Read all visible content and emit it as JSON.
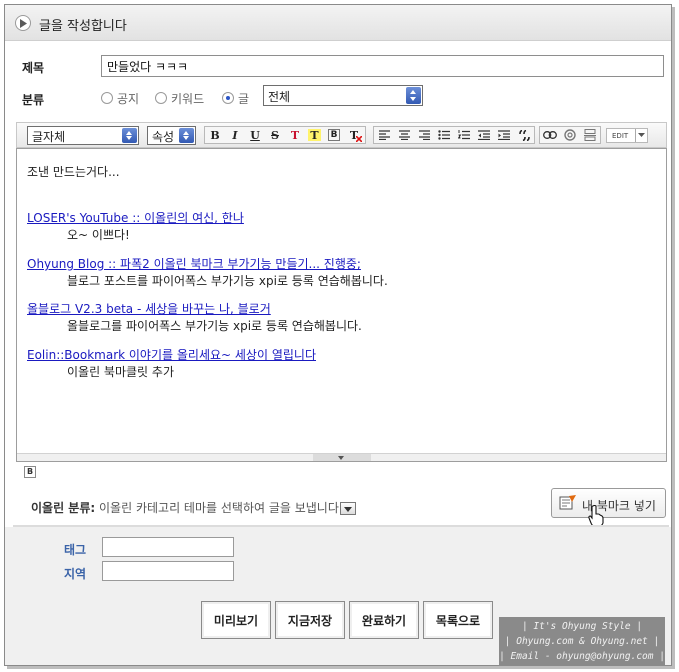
{
  "header": {
    "title": "글을 작성합니다"
  },
  "form": {
    "subject_label": "제목",
    "subject_value": "만들었다 ㅋㅋㅋ",
    "category_label": "분류",
    "radios": [
      {
        "label": "공지",
        "checked": false
      },
      {
        "label": "키워드",
        "checked": false
      },
      {
        "label": "글",
        "checked": true
      }
    ],
    "category_select": "전체"
  },
  "toolbar": {
    "font_select": "글자체",
    "attr_select": "속성",
    "bold": "B",
    "italic": "I",
    "underline": "U",
    "strike": "S",
    "text_color": "T",
    "bg_color": "T",
    "box": "B",
    "clear": "T",
    "edit_label": "EDIT"
  },
  "editor": {
    "line1": "조낸 만드는거다...",
    "items": [
      {
        "link": "LOSER's YouTube :: 이올린의 여신, 한나",
        "desc": "오~ 이쁘다!"
      },
      {
        "link": "Ohyung Blog :: 파폭2 이올린 북마크 부가기능 만들기... 진행중;",
        "desc": "블로그 포스트를 파이어폭스 부가기능 xpi로 등록 연습해봅니다."
      },
      {
        "link": "올블로그 V2.3 beta - 세상을 바꾸는 나, 블로거",
        "desc": "올블로그를 파이어폭스 부가기능 xpi로 등록 연습해봅니다."
      },
      {
        "link": "Eolin::Bookmark 이야기를 올리세요~ 세상이 열립니다",
        "desc": "이올린 북마클릿 추가"
      }
    ]
  },
  "insert_icon_text": "B",
  "eolin": {
    "label": "이올린 분류:",
    "text": "이올린 카테고리 테마를 선택하여 글을 보냅니다"
  },
  "bookmark_button": "내 북마크 넣기",
  "fields": {
    "tag_label": "태그",
    "location_label": "지역"
  },
  "actions": [
    "미리보기",
    "지금저장",
    "완료하기",
    "목록으로"
  ],
  "credit": {
    "line1": "| It's Ohyung Style |",
    "line2": "| Ohyung.com & Ohyung.net |",
    "line3": "| Email - ohyung@ohyung.com |"
  },
  "colors": {
    "link": "#1a1ac0",
    "select_arrow": "#3259b3",
    "field_label": "#3a63a8"
  }
}
